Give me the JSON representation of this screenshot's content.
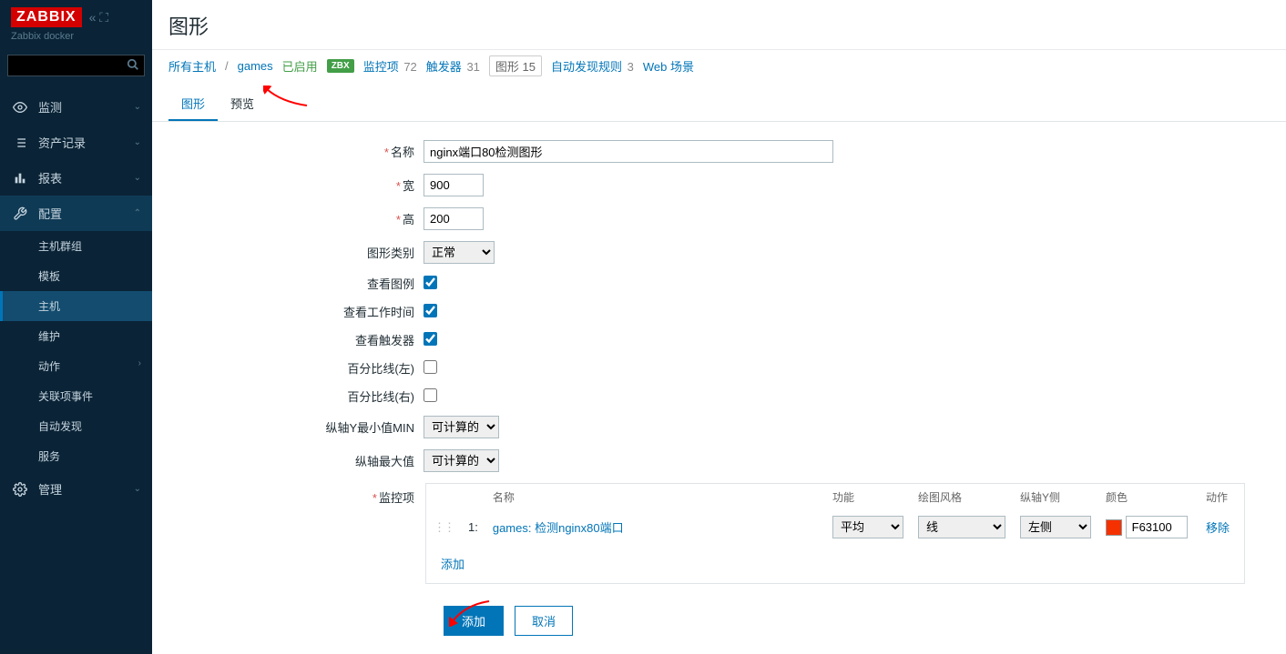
{
  "sidebar": {
    "logo": "ZABBIX",
    "subtitle": "Zabbix docker",
    "search_placeholder": "",
    "nav": [
      {
        "label": "监测",
        "icon": "eye"
      },
      {
        "label": "资产记录",
        "icon": "list"
      },
      {
        "label": "报表",
        "icon": "bar"
      },
      {
        "label": "配置",
        "icon": "wrench",
        "expanded": true,
        "children": [
          {
            "label": "主机群组"
          },
          {
            "label": "模板"
          },
          {
            "label": "主机",
            "selected": true
          },
          {
            "label": "维护"
          },
          {
            "label": "动作",
            "arrow": true
          },
          {
            "label": "关联项事件"
          },
          {
            "label": "自动发现"
          },
          {
            "label": "服务"
          }
        ]
      },
      {
        "label": "管理",
        "icon": "gear"
      }
    ]
  },
  "header": {
    "title": "图形"
  },
  "breadcrumb": {
    "all_hosts": "所有主机",
    "host": "games",
    "enabled": "已启用",
    "zbx": "ZBX",
    "items": {
      "label": "监控项",
      "count": "72"
    },
    "triggers": {
      "label": "触发器",
      "count": "31"
    },
    "graphs": {
      "label": "图形",
      "count": "15"
    },
    "discovery": {
      "label": "自动发现规则",
      "count": "3"
    },
    "web": "Web 场景"
  },
  "tabs": {
    "graph": "图形",
    "preview": "预览"
  },
  "form": {
    "name_label": "名称",
    "name_value": "nginx端口80检测图形",
    "width_label": "宽",
    "width_value": "900",
    "height_label": "高",
    "height_value": "200",
    "graph_type_label": "图形类别",
    "graph_type_value": "正常",
    "show_legend_label": "查看图例",
    "show_worktime_label": "查看工作时间",
    "show_trigger_label": "查看触发器",
    "percent_left_label": "百分比线(左)",
    "percent_right_label": "百分比线(右)",
    "yaxis_min_label": "纵轴Y最小值MIN",
    "yaxis_min_value": "可计算的",
    "yaxis_max_label": "纵轴最大值",
    "yaxis_max_value": "可计算的",
    "items_label": "监控项"
  },
  "items_table": {
    "cols": {
      "name": "名称",
      "func": "功能",
      "drawtype": "绘图风格",
      "yaxis": "纵轴Y侧",
      "color": "颜色",
      "action": "动作"
    },
    "rows": [
      {
        "idx": "1:",
        "name": "games: 检测nginx80端口",
        "func": "平均",
        "drawtype": "线",
        "yaxis": "左侧",
        "color_hex": "F63100",
        "remove": "移除"
      }
    ],
    "add_link": "添加"
  },
  "buttons": {
    "submit": "添加",
    "cancel": "取消"
  }
}
